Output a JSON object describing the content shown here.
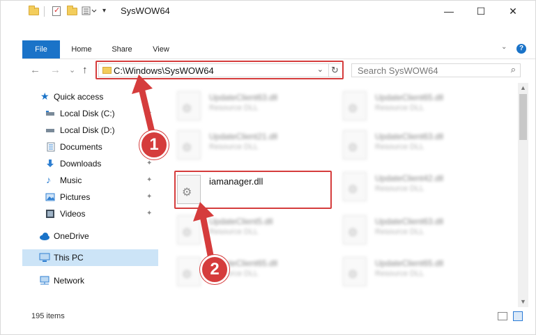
{
  "window": {
    "title": "SysWOW64",
    "minimize_glyph": "—",
    "maximize_glyph": "☐",
    "close_glyph": "✕"
  },
  "ribbon": {
    "tabs": [
      {
        "label": "File"
      },
      {
        "label": "Home"
      },
      {
        "label": "Share"
      },
      {
        "label": "View"
      }
    ],
    "help_glyph": "?",
    "collapse_glyph": "⌄"
  },
  "nav": {
    "back_glyph": "←",
    "forward_glyph": "→",
    "recent_glyph": "⌄",
    "up_glyph": "↑",
    "address": "C:\\Windows\\SysWOW64",
    "address_dropdown_glyph": "⌄",
    "refresh_glyph": "↻",
    "search_placeholder": "Search SysWOW64",
    "search_glyph": "⌕"
  },
  "sidebar": {
    "items": [
      {
        "label": "Quick access",
        "icon": "star-icon",
        "pinned": false
      },
      {
        "label": "Local Disk (C:)",
        "icon": "drive-icon",
        "pinned": true
      },
      {
        "label": "Local Disk (D:)",
        "icon": "drive-icon",
        "pinned": false
      },
      {
        "label": "Documents",
        "icon": "documents-icon",
        "pinned": true
      },
      {
        "label": "Downloads",
        "icon": "download-icon",
        "pinned": true
      },
      {
        "label": "Music",
        "icon": "music-icon",
        "pinned": true
      },
      {
        "label": "Pictures",
        "icon": "pictures-icon",
        "pinned": true
      },
      {
        "label": "Videos",
        "icon": "videos-icon",
        "pinned": true
      },
      {
        "label": "OneDrive",
        "icon": "cloud-icon",
        "pinned": false
      },
      {
        "label": "This PC",
        "icon": "computer-icon",
        "pinned": false,
        "selected": true
      },
      {
        "label": "Network",
        "icon": "network-icon",
        "pinned": false
      }
    ],
    "pin_glyph": "📌"
  },
  "files": {
    "left_column": [
      {
        "name": "UpdateClient63.dll",
        "type": "Resource DLL"
      },
      {
        "name": "UpdateClient21.dll",
        "type": "Resource DLL"
      },
      {
        "name": "iamanager.dll",
        "type": ""
      },
      {
        "name": "UpdateClient5.dll",
        "type": "Resource DLL"
      },
      {
        "name": "UpdateClient65.dll",
        "type": "Resource DLL"
      }
    ],
    "right_column": [
      {
        "name": "UpdateClient65.dll",
        "type": "Resource DLL"
      },
      {
        "name": "UpdateClient63.dll",
        "type": "Resource DLL"
      },
      {
        "name": "UpdateClient42.dll",
        "type": "Resource DLL"
      },
      {
        "name": "UpdateClient63.dll",
        "type": "Resource DLL"
      },
      {
        "name": "UpdateClient65.dll",
        "type": "Resource DLL"
      }
    ]
  },
  "status": {
    "item_count": "195 items"
  },
  "annotations": {
    "step1": "1",
    "step2": "2",
    "accent_color": "#d53c3c"
  }
}
